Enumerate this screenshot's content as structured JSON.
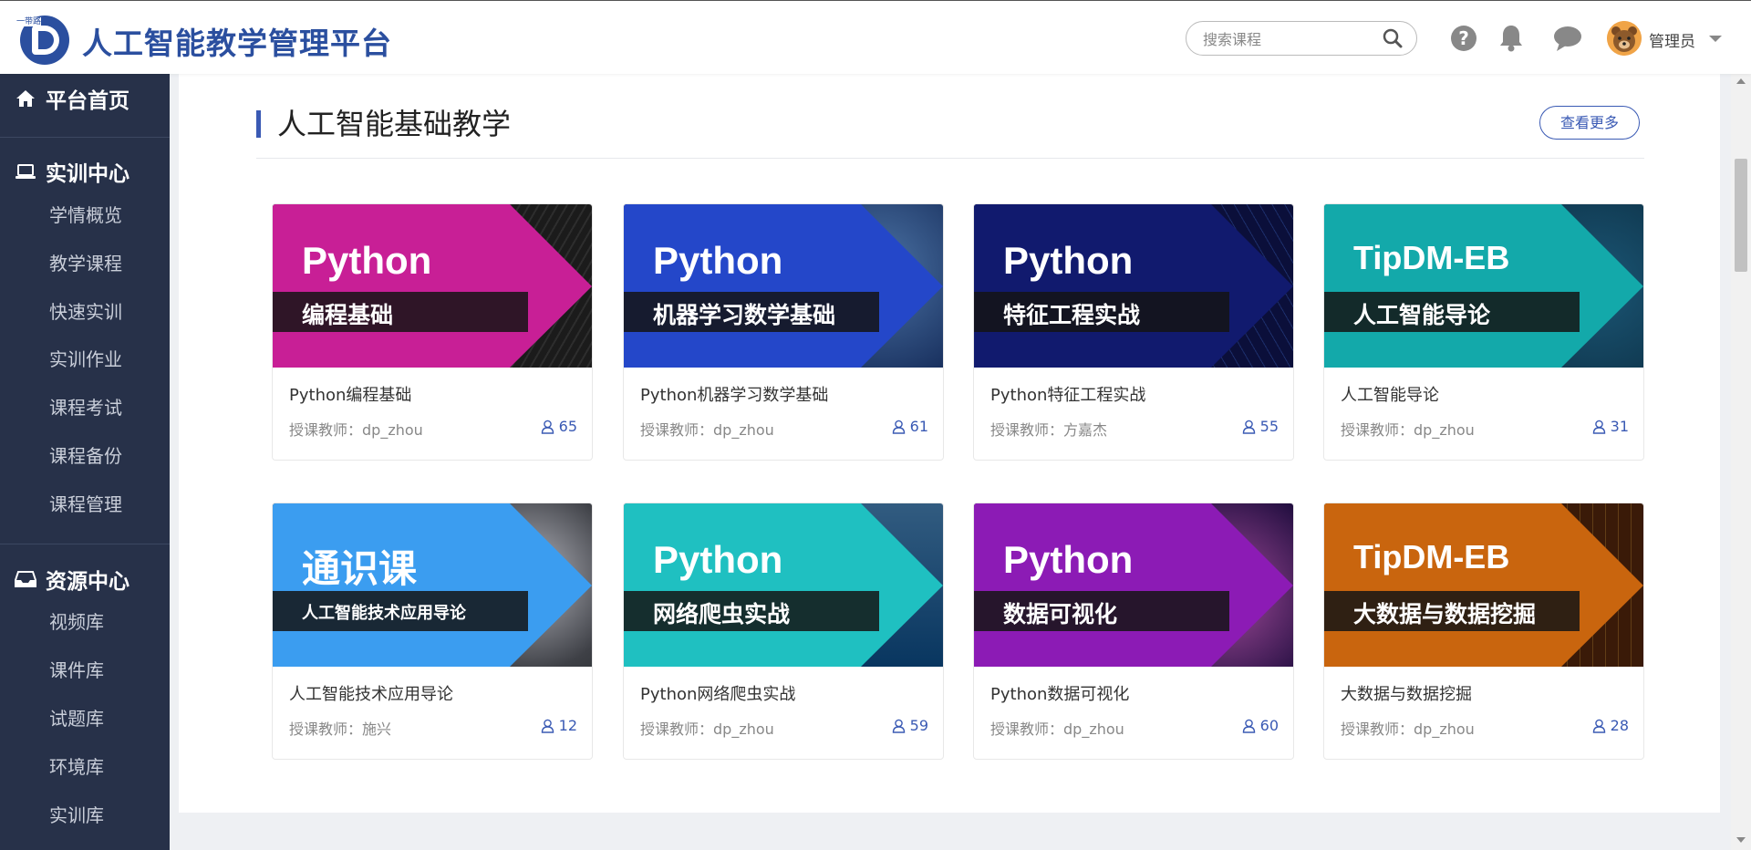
{
  "header": {
    "logo_tag": "一带路",
    "title": "人工智能教学管理平台",
    "search_placeholder": "搜索课程",
    "user_name": "管理员",
    "icons": [
      "search-icon",
      "help-icon",
      "bell-icon",
      "chat-icon",
      "caret-down-icon"
    ]
  },
  "sidebar": {
    "home": "平台首页",
    "training": {
      "label": "实训中心",
      "items": [
        "学情概览",
        "教学课程",
        "快速实训",
        "实训作业",
        "课程考试",
        "课程备份",
        "课程管理"
      ]
    },
    "resources": {
      "label": "资源中心",
      "items": [
        "视频库",
        "课件库",
        "试题库",
        "环境库",
        "实训库"
      ]
    }
  },
  "section": {
    "title": "人工智能基础教学",
    "more_label": "查看更多"
  },
  "courses": [
    {
      "cover_big": "Python",
      "cover_sub": "编程基础",
      "title": "Python编程基础",
      "teacher": "授课教师：dp_zhou",
      "count": "65",
      "color": "#c81f96"
    },
    {
      "cover_big": "Python",
      "cover_sub": "机器学习数学基础",
      "title": "Python机器学习数学基础",
      "teacher": "授课教师：dp_zhou",
      "count": "61",
      "color": "#2447c9"
    },
    {
      "cover_big": "Python",
      "cover_sub": "特征工程实战",
      "title": "Python特征工程实战",
      "teacher": "授课教师：方嘉杰",
      "count": "55",
      "color": "#111a6e"
    },
    {
      "cover_big": "TipDM-EB",
      "cover_sub": "人工智能导论",
      "title": "人工智能导论",
      "teacher": "授课教师：dp_zhou",
      "count": "31",
      "color": "#13a9aa"
    },
    {
      "cover_big": "通识课",
      "cover_sub": "人工智能技术应用导论",
      "title": "人工智能技术应用导论",
      "teacher": "授课教师：施兴",
      "count": "12",
      "color": "#3b9df0"
    },
    {
      "cover_big": "Python",
      "cover_sub": "网络爬虫实战",
      "title": "Python网络爬虫实战",
      "teacher": "授课教师：dp_zhou",
      "count": "59",
      "color": "#1fc0c1"
    },
    {
      "cover_big": "Python",
      "cover_sub": "数据可视化",
      "title": "Python数据可视化",
      "teacher": "授课教师：dp_zhou",
      "count": "60",
      "color": "#8c1bb5"
    },
    {
      "cover_big": "TipDM-EB",
      "cover_sub": "大数据与数据挖掘",
      "title": "大数据与数据挖掘",
      "teacher": "授课教师：dp_zhou",
      "count": "28",
      "color": "#c9650e"
    }
  ],
  "colors": {
    "brand": "#2b4f9f",
    "sidebar_bg": "#273149",
    "accent": "#3a5ab4"
  }
}
